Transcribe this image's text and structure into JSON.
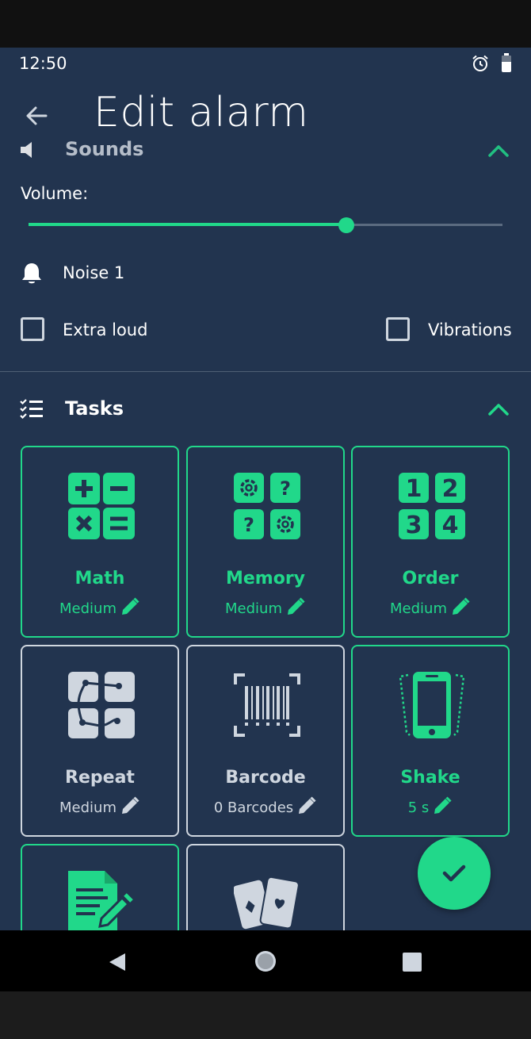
{
  "status_bar": {
    "time": "12:50"
  },
  "header": {
    "title": "Edit alarm"
  },
  "sounds": {
    "title": "Sounds",
    "volume_label": "Volume:",
    "volume_level": 0.67,
    "sound_name": "Noise 1",
    "extra_loud_label": "Extra loud",
    "extra_loud_checked": false,
    "vibrations_label": "Vibrations",
    "vibrations_checked": false
  },
  "tasks": {
    "title": "Tasks",
    "items": [
      {
        "name": "Math",
        "detail": "Medium",
        "active": true,
        "icon": "calculator-icon"
      },
      {
        "name": "Memory",
        "detail": "Medium",
        "active": true,
        "icon": "memory-cards-icon"
      },
      {
        "name": "Order",
        "detail": "Medium",
        "active": true,
        "icon": "numbers-order-icon"
      },
      {
        "name": "Repeat",
        "detail": "Medium",
        "active": false,
        "icon": "repeat-pattern-icon"
      },
      {
        "name": "Barcode",
        "detail": "0 Barcodes",
        "active": false,
        "icon": "barcode-icon"
      },
      {
        "name": "Shake",
        "detail": "5 s",
        "active": true,
        "icon": "shake-phone-icon"
      },
      {
        "name": "",
        "detail": "",
        "active": true,
        "icon": "document-edit-icon"
      },
      {
        "name": "",
        "detail": "",
        "active": false,
        "icon": "playing-cards-icon"
      }
    ]
  },
  "colors": {
    "accent": "#21d88a",
    "background": "#22344f",
    "muted": "#cfd6df"
  }
}
